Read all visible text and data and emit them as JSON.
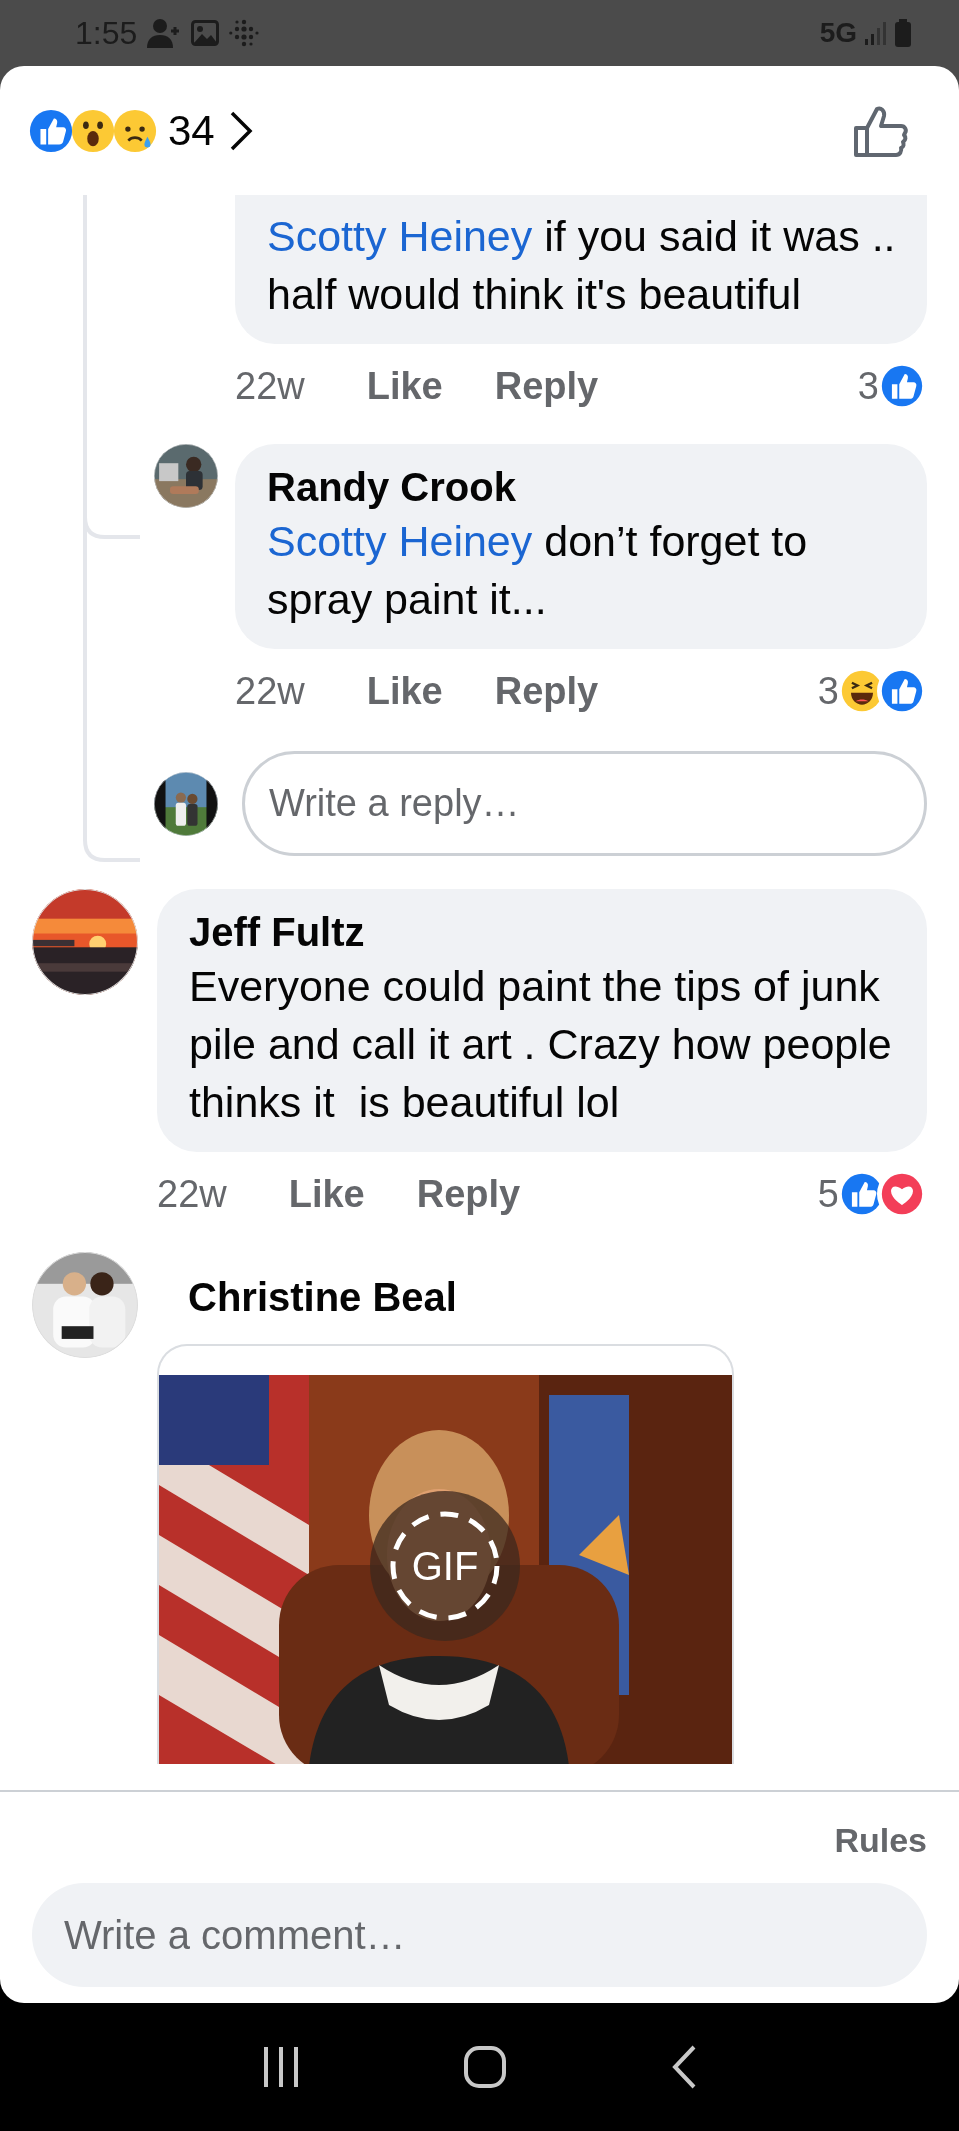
{
  "status_bar": {
    "time": "1:55",
    "network": "5G"
  },
  "header": {
    "reactions": [
      {
        "kind": "like"
      },
      {
        "kind": "wow"
      },
      {
        "kind": "sad"
      }
    ],
    "count": "34"
  },
  "thread": {
    "replies": [
      {
        "mention": "Scotty Heiney",
        "text": "if you said it was .. half would think it's beautiful",
        "time": "22w",
        "like": "Like",
        "reply": "Reply",
        "count": "3",
        "reactions": [
          {
            "kind": "like"
          }
        ]
      },
      {
        "author": "Randy Crook",
        "mention": "Scotty Heiney",
        "text": "don’t forget to spray paint it...",
        "time": "22w",
        "like": "Like",
        "reply": "Reply",
        "count": "3",
        "reactions": [
          {
            "kind": "haha"
          },
          {
            "kind": "like"
          }
        ]
      }
    ],
    "reply_field": {
      "placeholder": "Write a reply…"
    }
  },
  "comments": [
    {
      "kind": "text",
      "author": "Jeff Fultz",
      "text": "Everyone could paint the tips of junk pile and call it art . Crazy how people thinks it  is beautiful lol",
      "time": "22w",
      "like": "Like",
      "reply": "Reply",
      "count": "5",
      "reactions": [
        {
          "kind": "like"
        },
        {
          "kind": "love"
        }
      ]
    },
    {
      "kind": "gif",
      "author": "Christine Beal",
      "badge": "GIF"
    }
  ],
  "footer": {
    "rules": "Rules",
    "comment_field": {
      "placeholder": "Write a comment…"
    }
  }
}
